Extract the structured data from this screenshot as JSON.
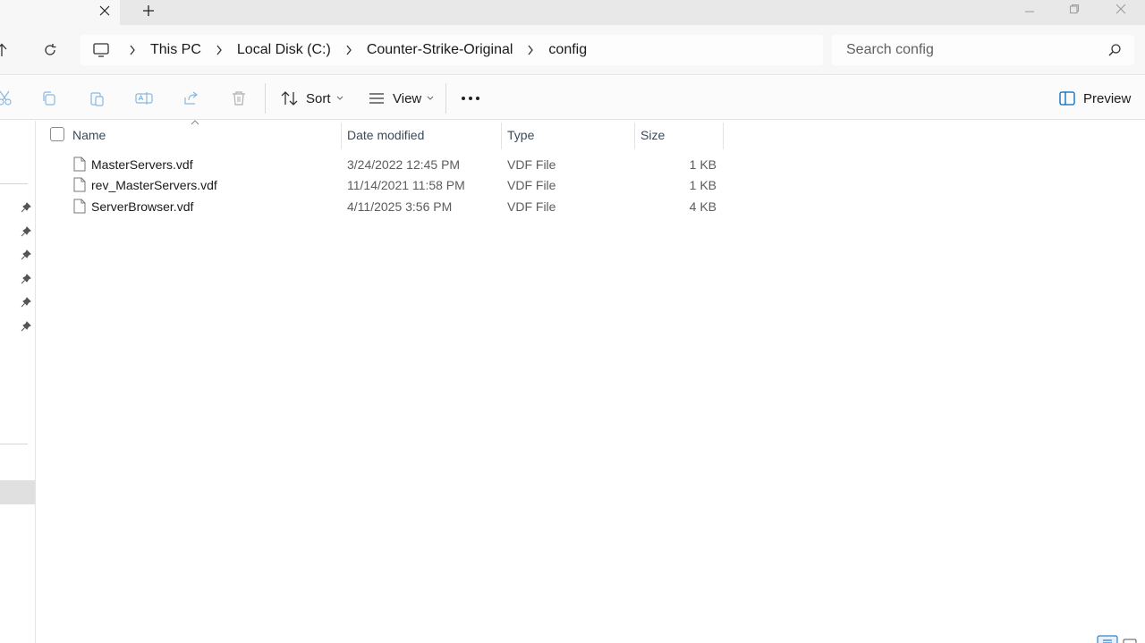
{
  "breadcrumb": {
    "items": [
      "This PC",
      "Local Disk (C:)",
      "Counter-Strike-Original",
      "config"
    ]
  },
  "search": {
    "placeholder": "Search config"
  },
  "toolbar": {
    "sort_label": "Sort",
    "view_label": "View",
    "preview_label": "Preview"
  },
  "columns": {
    "name": "Name",
    "date": "Date modified",
    "type": "Type",
    "size": "Size"
  },
  "files": [
    {
      "name": "MasterServers.vdf",
      "date": "3/24/2022 12:45 PM",
      "type": "VDF File",
      "size": "1 KB"
    },
    {
      "name": "rev_MasterServers.vdf",
      "date": "11/14/2021 11:58 PM",
      "type": "VDF File",
      "size": "1 KB"
    },
    {
      "name": "ServerBrowser.vdf",
      "date": "4/11/2025 3:56 PM",
      "type": "VDF File",
      "size": "4 KB"
    }
  ],
  "colors": {
    "accent": "#0067c0",
    "selection": "#e0e0e0"
  }
}
